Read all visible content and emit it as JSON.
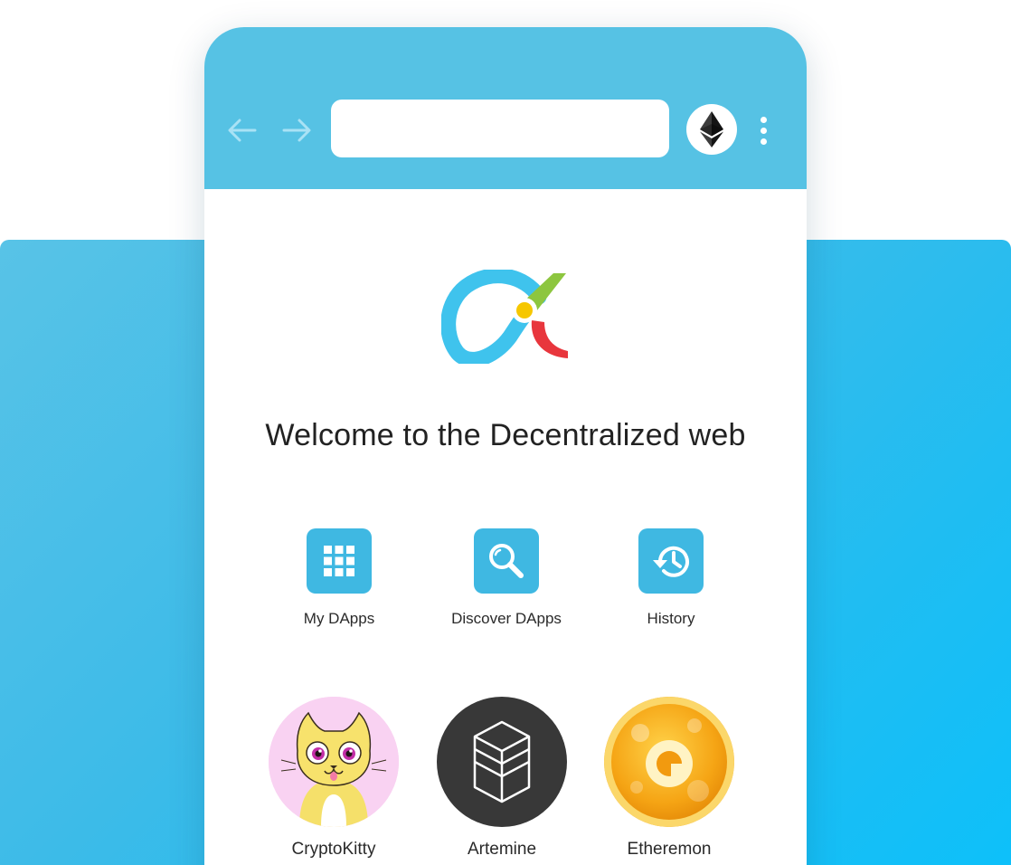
{
  "browser": {
    "url_value": "",
    "back_icon": "arrow-left-icon",
    "forward_icon": "arrow-right-icon",
    "wallet_icon": "ethereum-icon",
    "menu_icon": "more-vertical-icon"
  },
  "home": {
    "welcome": "Welcome to the Decentralized web",
    "quick_actions": [
      {
        "label": "My DApps",
        "icon": "grid-icon"
      },
      {
        "label": "Discover DApps",
        "icon": "search-icon"
      },
      {
        "label": "History",
        "icon": "history-icon"
      }
    ],
    "dapps": [
      {
        "label": "CryptoKitty",
        "icon": "cryptokitty-icon"
      },
      {
        "label": "Artemine",
        "icon": "artemine-icon"
      },
      {
        "label": "Etheremon",
        "icon": "etheremon-icon"
      }
    ]
  },
  "colors": {
    "toolbar": "#56c2e4",
    "tile": "#3fb8e2",
    "backdrop_start": "#58c3e7",
    "backdrop_end": "#0dc0fa"
  }
}
